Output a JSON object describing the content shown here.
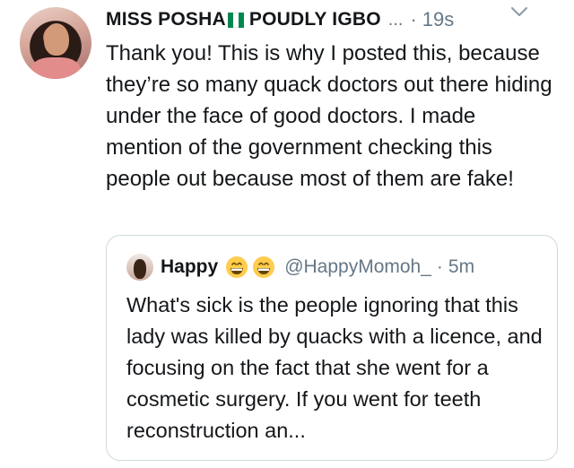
{
  "tweet": {
    "display_name": "MISS POSHA",
    "display_name_suffix": "POUDLY IGBO",
    "truncation": "...",
    "separator": "·",
    "time": "19s",
    "body": "Thank you! This is why I posted this, because they’re so many quack doctors out there hiding under the face of good doctors. I made mention  of the government checking this people out because most of them are fake!",
    "flag_colors": [
      "#008751",
      "#ffffff",
      "#008751"
    ]
  },
  "quoted_tweet": {
    "display_name": "Happy",
    "emoji": [
      "grinning-face-icon",
      "grinning-face-icon"
    ],
    "handle": "@HappyMomoh_",
    "separator": "·",
    "time": "5m",
    "body": "What's sick is the people ignoring that this lady was killed by quacks with a licence, and focusing on the fact that she went for a cosmetic surgery. If you went for teeth reconstruction an..."
  },
  "colors": {
    "text": "#14171a",
    "secondary": "#657786",
    "border": "#cfd9de"
  }
}
